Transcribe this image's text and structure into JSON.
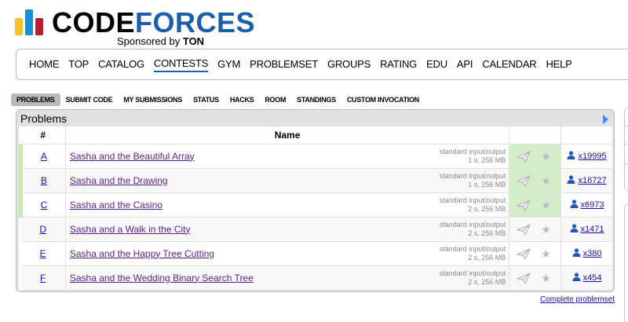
{
  "brand": {
    "name_part1": "CODE",
    "name_part2": "FORCES",
    "sponsor_prefix": "Sponsored by",
    "sponsor_name": "TON"
  },
  "menu": [
    {
      "label": "HOME",
      "active": false
    },
    {
      "label": "TOP",
      "active": false
    },
    {
      "label": "CATALOG",
      "active": false
    },
    {
      "label": "CONTESTS",
      "active": true
    },
    {
      "label": "GYM",
      "active": false
    },
    {
      "label": "PROBLEMSET",
      "active": false
    },
    {
      "label": "GROUPS",
      "active": false
    },
    {
      "label": "RATING",
      "active": false
    },
    {
      "label": "EDU",
      "active": false
    },
    {
      "label": "API",
      "active": false
    },
    {
      "label": "CALENDAR",
      "active": false
    },
    {
      "label": "HELP",
      "active": false
    }
  ],
  "submenu": [
    {
      "label": "PROBLEMS",
      "active": true
    },
    {
      "label": "SUBMIT CODE",
      "active": false
    },
    {
      "label": "MY SUBMISSIONS",
      "active": false
    },
    {
      "label": "STATUS",
      "active": false
    },
    {
      "label": "HACKS",
      "active": false
    },
    {
      "label": "ROOM",
      "active": false
    },
    {
      "label": "STANDINGS",
      "active": false
    },
    {
      "label": "CUSTOM INVOCATION",
      "active": false
    }
  ],
  "problems_box": {
    "title": "Problems",
    "columns": {
      "index": "#",
      "name": "Name"
    },
    "rows": [
      {
        "index": "A",
        "name": "Sasha and the Beautiful Array",
        "io": "standard input/output",
        "limits": "1 s, 256 MB",
        "solved": "x19995",
        "accepted": true
      },
      {
        "index": "B",
        "name": "Sasha and the Drawing",
        "io": "standard input/output",
        "limits": "1 s, 256 MB",
        "solved": "x16727",
        "accepted": true
      },
      {
        "index": "C",
        "name": "Sasha and the Casino",
        "io": "standard input/output",
        "limits": "2 s, 256 MB",
        "solved": "x6973",
        "accepted": true
      },
      {
        "index": "D",
        "name": "Sasha and a Walk in the City",
        "io": "standard input/output",
        "limits": "2 s, 256 MB",
        "solved": "x1471",
        "accepted": false
      },
      {
        "index": "E",
        "name": "Sasha and the Happy Tree Cutting",
        "io": "standard input/output",
        "limits": "2 s, 256 MB",
        "solved": "x380",
        "accepted": false
      },
      {
        "index": "F",
        "name": "Sasha and the Wedding Binary Search Tree",
        "io": "standard input/output",
        "limits": "2 s, 256 MB",
        "solved": "x454",
        "accepted": false
      }
    ],
    "complete_link": "Complete problemset"
  },
  "colors": {
    "accepted_bg": "#d4edc9",
    "link": "#1a0dab",
    "visited_link": "#5b1f8a",
    "brand_blue": "#1b5fa8"
  }
}
